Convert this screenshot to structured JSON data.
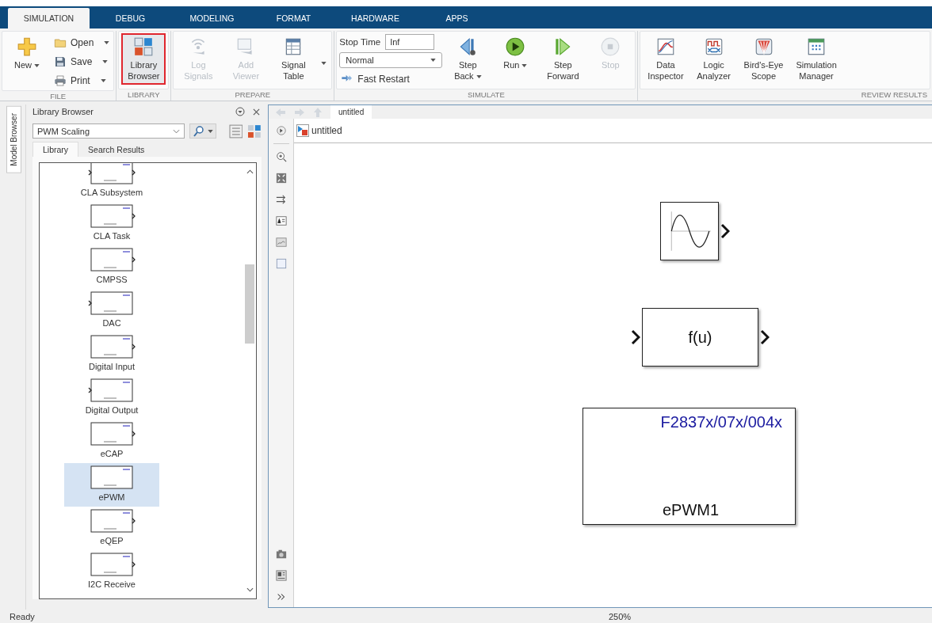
{
  "tabs": [
    {
      "label": "SIMULATION",
      "selected": true
    },
    {
      "label": "DEBUG",
      "selected": false
    },
    {
      "label": "MODELING",
      "selected": false
    },
    {
      "label": "FORMAT",
      "selected": false
    },
    {
      "label": "HARDWARE",
      "selected": false
    },
    {
      "label": "APPS",
      "selected": false
    }
  ],
  "ribbon": [
    {
      "label": "FILE",
      "items": [
        {
          "kind": "large",
          "label": "New",
          "menu": true,
          "disabled": false,
          "highlighted": false
        },
        {
          "kind": "stack",
          "items": [
            {
              "kind": "button",
              "label": "Open",
              "menu": true
            },
            {
              "kind": "button",
              "label": "Save",
              "menu": true
            },
            {
              "kind": "button",
              "label": "Print",
              "menu": true
            }
          ]
        }
      ]
    },
    {
      "label": "LIBRARY",
      "items": [
        {
          "kind": "large",
          "label": "Library\nBrowser",
          "menu": false,
          "disabled": false,
          "highlighted": true
        }
      ]
    },
    {
      "label": "PREPARE",
      "items": [
        {
          "kind": "large",
          "label": "Log\nSignals",
          "menu": false,
          "disabled": true,
          "highlighted": false
        },
        {
          "kind": "large",
          "label": "Add\nViewer",
          "menu": false,
          "disabled": true,
          "highlighted": false
        },
        {
          "kind": "large",
          "label": "Signal\nTable",
          "menu": false,
          "disabled": false,
          "highlighted": false
        },
        {
          "kind": "more"
        }
      ]
    },
    {
      "label": "SIMULATE",
      "items": [
        {
          "kind": "stack",
          "items": [
            {
              "kind": "field",
              "label": "Stop Time",
              "value": "Inf"
            },
            {
              "kind": "dropdown",
              "value": "Normal"
            },
            {
              "kind": "button",
              "label": "Fast Restart",
              "menu": false
            }
          ]
        },
        {
          "kind": "large",
          "label": "Step\nBack",
          "menu": true,
          "disabled": false,
          "highlighted": false
        },
        {
          "kind": "large",
          "label": "Run",
          "menu": true,
          "disabled": false,
          "highlighted": false
        },
        {
          "kind": "large",
          "label": "Step\nForward",
          "menu": false,
          "disabled": false,
          "highlighted": false
        },
        {
          "kind": "large",
          "label": "Stop",
          "menu": false,
          "disabled": true,
          "highlighted": false
        }
      ]
    },
    {
      "label": "REVIEW RESULTS",
      "items": [
        {
          "kind": "large",
          "label": "Data\nInspector",
          "menu": false,
          "disabled": false,
          "highlighted": false
        },
        {
          "kind": "large",
          "label": "Logic\nAnalyzer",
          "menu": false,
          "disabled": false,
          "highlighted": false
        },
        {
          "kind": "large",
          "label": "Bird's-Eye\nScope",
          "menu": false,
          "disabled": false,
          "highlighted": false
        },
        {
          "kind": "large",
          "label": "Simulation\nManager",
          "menu": false,
          "disabled": false,
          "highlighted": false
        }
      ]
    }
  ],
  "side_tab": {
    "label": "Model Browser"
  },
  "library_browser": {
    "title": "Library Browser",
    "search": {
      "value": "PWM Scaling"
    },
    "tabs": [
      {
        "label": "Library",
        "selected": true
      },
      {
        "label": "Search Results",
        "selected": false
      }
    ],
    "blocks": [
      {
        "label": "CLA Subsystem",
        "selected": false,
        "input": true,
        "output": true
      },
      {
        "label": "CLA Task",
        "selected": false,
        "input": false,
        "output": true
      },
      {
        "label": "CMPSS",
        "selected": false,
        "input": false,
        "output": true
      },
      {
        "label": "DAC",
        "selected": false,
        "input": true,
        "output": false
      },
      {
        "label": "Digital Input",
        "selected": false,
        "input": false,
        "output": true
      },
      {
        "label": "Digital Output",
        "selected": false,
        "input": true,
        "output": false
      },
      {
        "label": "eCAP",
        "selected": false,
        "input": false,
        "output": true
      },
      {
        "label": "ePWM",
        "selected": true,
        "input": false,
        "output": false
      },
      {
        "label": "eQEP",
        "selected": false,
        "input": false,
        "output": true
      },
      {
        "label": "I2C Receive",
        "selected": false,
        "input": false,
        "output": true
      }
    ]
  },
  "editor": {
    "tab": "untitled",
    "breadcrumb": "untitled",
    "blocks": [
      {
        "kind": "sine",
        "input": false,
        "output": true
      },
      {
        "kind": "function",
        "label": "f(u)",
        "input": true,
        "output": true
      },
      {
        "kind": "peripheral",
        "header": "F2837x/07x/004x",
        "label": "ePWM1",
        "input": false,
        "output": false
      }
    ]
  },
  "status_bar": {
    "message": "Ready",
    "zoom": "250%"
  }
}
